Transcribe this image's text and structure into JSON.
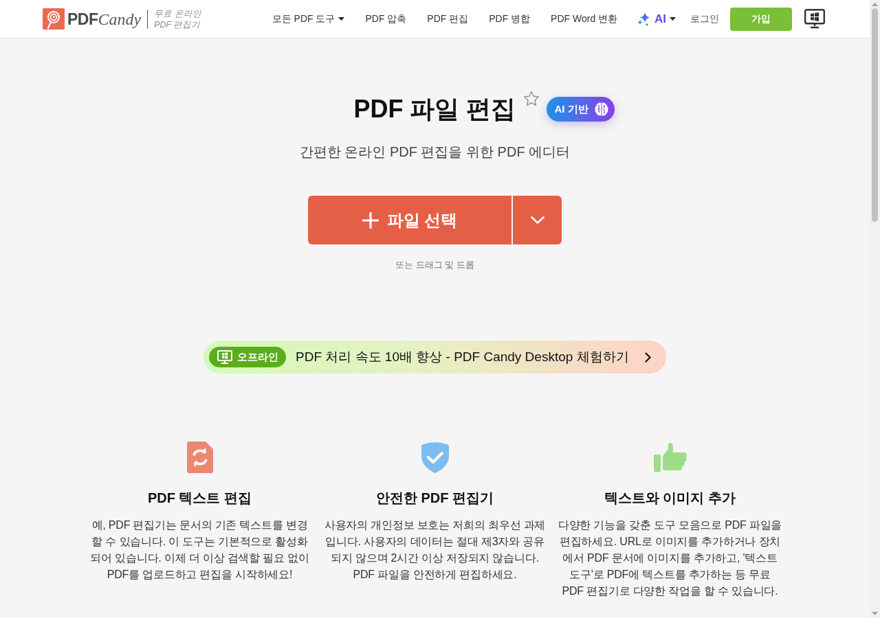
{
  "header": {
    "logo": {
      "brand": "PDF",
      "product": "Candy"
    },
    "tagline": [
      "무료 온라인",
      "PDF 편집기"
    ],
    "nav": [
      {
        "label": "모든 PDF 도구",
        "has_menu": true
      },
      {
        "label": "PDF 압축",
        "has_menu": false
      },
      {
        "label": "PDF 편집",
        "has_menu": false
      },
      {
        "label": "PDF 병합",
        "has_menu": false
      },
      {
        "label": "PDF Word 변환",
        "has_menu": false
      }
    ],
    "ai_menu": {
      "label": "AI"
    },
    "login": "로그인",
    "signup": "가입"
  },
  "hero": {
    "title": "PDF 파일 편집",
    "favorited": false,
    "badge": "AI 기반",
    "subtitle": "간편한 온라인 PDF 편집을 위한 PDF 에디터",
    "upload_button": "파일 선택",
    "drop_hint": "또는 드래그 및 드롭"
  },
  "banner": {
    "badge": "오프라인",
    "text": "PDF 처리 속도 10배 향상 - PDF Candy Desktop 체험하기"
  },
  "features": [
    {
      "kind": "document",
      "color": "#ec8872",
      "title": "PDF 텍스트 편집",
      "text": "예, PDF 편집기는 문서의 기존 텍스트를 변경할 수 있습니다. 이 도구는 기본적으로 활성화되어 있습니다. 이제 더 이상 검색할 필요 없이 PDF를 업로드하고 편집을 시작하세요!"
    },
    {
      "kind": "shield",
      "color": "#7dbcf0",
      "title": "안전한 PDF 편집기",
      "text": "사용자의 개인정보 보호는 저희의 최우선 과제입니다. 사용자의 데이터는 절대 제3자와 공유되지 않으며 2시간 이상 저장되지 않습니다. PDF 파일을 안전하게 편집하세요."
    },
    {
      "kind": "thumbs-up",
      "color": "#9edc8a",
      "title": "텍스트와 이미지 추가",
      "text": "다양한 기능을 갖춘 도구 모음으로 PDF 파일을 편집하세요. URL로 이미지를 추가하거나 장치에서 PDF 문서에 이미지를 추가하고, '텍스트 도구'로 PDF에 텍스트를 추가하는 등 무료 PDF 편집기로 다양한 작업을 할 수 있습니다."
    }
  ]
}
